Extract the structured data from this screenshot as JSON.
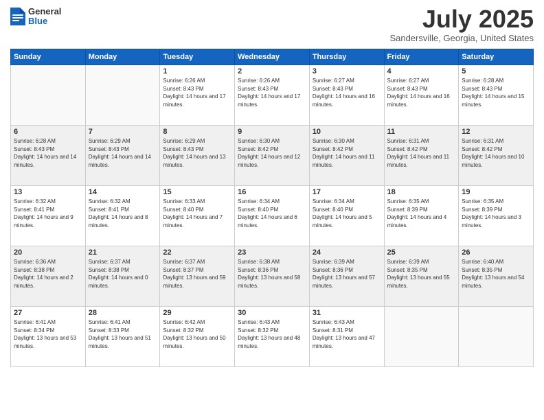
{
  "header": {
    "logo": {
      "line1": "General",
      "line2": "Blue"
    },
    "title": "July 2025",
    "location": "Sandersville, Georgia, United States"
  },
  "days_of_week": [
    "Sunday",
    "Monday",
    "Tuesday",
    "Wednesday",
    "Thursday",
    "Friday",
    "Saturday"
  ],
  "weeks": [
    [
      {
        "day": "",
        "info": ""
      },
      {
        "day": "",
        "info": ""
      },
      {
        "day": "1",
        "info": "Sunrise: 6:26 AM\nSunset: 8:43 PM\nDaylight: 14 hours and 17 minutes."
      },
      {
        "day": "2",
        "info": "Sunrise: 6:26 AM\nSunset: 8:43 PM\nDaylight: 14 hours and 17 minutes."
      },
      {
        "day": "3",
        "info": "Sunrise: 6:27 AM\nSunset: 8:43 PM\nDaylight: 14 hours and 16 minutes."
      },
      {
        "day": "4",
        "info": "Sunrise: 6:27 AM\nSunset: 8:43 PM\nDaylight: 14 hours and 16 minutes."
      },
      {
        "day": "5",
        "info": "Sunrise: 6:28 AM\nSunset: 8:43 PM\nDaylight: 14 hours and 15 minutes."
      }
    ],
    [
      {
        "day": "6",
        "info": "Sunrise: 6:28 AM\nSunset: 8:43 PM\nDaylight: 14 hours and 14 minutes."
      },
      {
        "day": "7",
        "info": "Sunrise: 6:29 AM\nSunset: 8:43 PM\nDaylight: 14 hours and 14 minutes."
      },
      {
        "day": "8",
        "info": "Sunrise: 6:29 AM\nSunset: 8:43 PM\nDaylight: 14 hours and 13 minutes."
      },
      {
        "day": "9",
        "info": "Sunrise: 6:30 AM\nSunset: 8:42 PM\nDaylight: 14 hours and 12 minutes."
      },
      {
        "day": "10",
        "info": "Sunrise: 6:30 AM\nSunset: 8:42 PM\nDaylight: 14 hours and 11 minutes."
      },
      {
        "day": "11",
        "info": "Sunrise: 6:31 AM\nSunset: 8:42 PM\nDaylight: 14 hours and 11 minutes."
      },
      {
        "day": "12",
        "info": "Sunrise: 6:31 AM\nSunset: 8:42 PM\nDaylight: 14 hours and 10 minutes."
      }
    ],
    [
      {
        "day": "13",
        "info": "Sunrise: 6:32 AM\nSunset: 8:41 PM\nDaylight: 14 hours and 9 minutes."
      },
      {
        "day": "14",
        "info": "Sunrise: 6:32 AM\nSunset: 8:41 PM\nDaylight: 14 hours and 8 minutes."
      },
      {
        "day": "15",
        "info": "Sunrise: 6:33 AM\nSunset: 8:40 PM\nDaylight: 14 hours and 7 minutes."
      },
      {
        "day": "16",
        "info": "Sunrise: 6:34 AM\nSunset: 8:40 PM\nDaylight: 14 hours and 6 minutes."
      },
      {
        "day": "17",
        "info": "Sunrise: 6:34 AM\nSunset: 8:40 PM\nDaylight: 14 hours and 5 minutes."
      },
      {
        "day": "18",
        "info": "Sunrise: 6:35 AM\nSunset: 8:39 PM\nDaylight: 14 hours and 4 minutes."
      },
      {
        "day": "19",
        "info": "Sunrise: 6:35 AM\nSunset: 8:39 PM\nDaylight: 14 hours and 3 minutes."
      }
    ],
    [
      {
        "day": "20",
        "info": "Sunrise: 6:36 AM\nSunset: 8:38 PM\nDaylight: 14 hours and 2 minutes."
      },
      {
        "day": "21",
        "info": "Sunrise: 6:37 AM\nSunset: 8:38 PM\nDaylight: 14 hours and 0 minutes."
      },
      {
        "day": "22",
        "info": "Sunrise: 6:37 AM\nSunset: 8:37 PM\nDaylight: 13 hours and 59 minutes."
      },
      {
        "day": "23",
        "info": "Sunrise: 6:38 AM\nSunset: 8:36 PM\nDaylight: 13 hours and 58 minutes."
      },
      {
        "day": "24",
        "info": "Sunrise: 6:39 AM\nSunset: 8:36 PM\nDaylight: 13 hours and 57 minutes."
      },
      {
        "day": "25",
        "info": "Sunrise: 6:39 AM\nSunset: 8:35 PM\nDaylight: 13 hours and 55 minutes."
      },
      {
        "day": "26",
        "info": "Sunrise: 6:40 AM\nSunset: 8:35 PM\nDaylight: 13 hours and 54 minutes."
      }
    ],
    [
      {
        "day": "27",
        "info": "Sunrise: 6:41 AM\nSunset: 8:34 PM\nDaylight: 13 hours and 53 minutes."
      },
      {
        "day": "28",
        "info": "Sunrise: 6:41 AM\nSunset: 8:33 PM\nDaylight: 13 hours and 51 minutes."
      },
      {
        "day": "29",
        "info": "Sunrise: 6:42 AM\nSunset: 8:32 PM\nDaylight: 13 hours and 50 minutes."
      },
      {
        "day": "30",
        "info": "Sunrise: 6:43 AM\nSunset: 8:32 PM\nDaylight: 13 hours and 48 minutes."
      },
      {
        "day": "31",
        "info": "Sunrise: 6:43 AM\nSunset: 8:31 PM\nDaylight: 13 hours and 47 minutes."
      },
      {
        "day": "",
        "info": ""
      },
      {
        "day": "",
        "info": ""
      }
    ]
  ]
}
